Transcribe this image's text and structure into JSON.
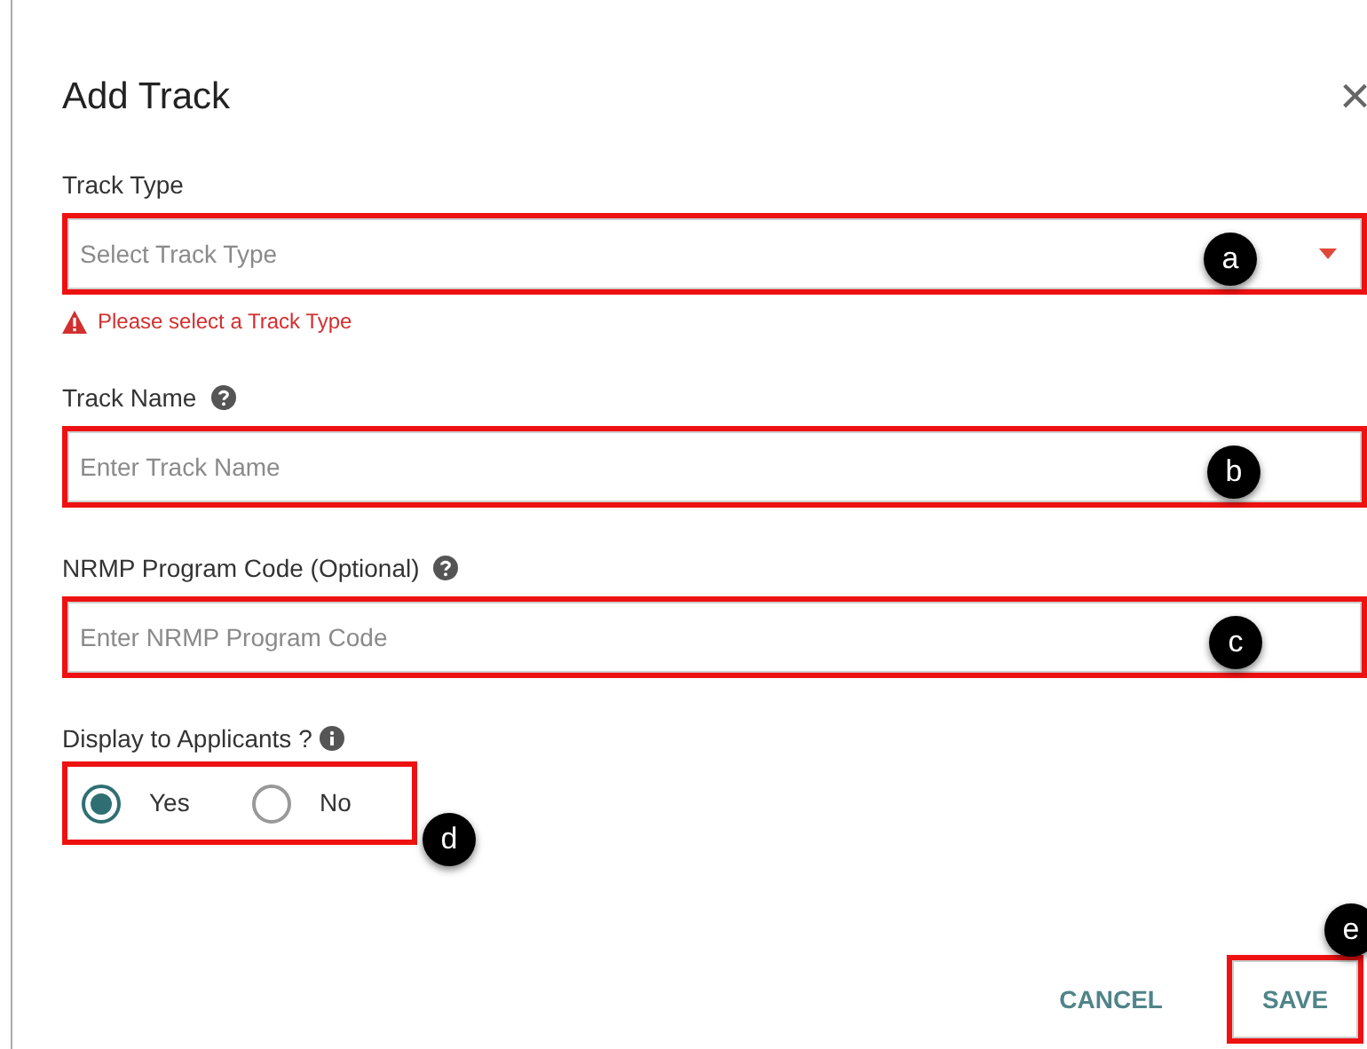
{
  "dialog": {
    "title": "Add Track",
    "close": "×"
  },
  "fields": [
    {
      "kind": "select",
      "label": "Track Type",
      "placeholder": "Select Track Type",
      "error": "Please select a Track Type",
      "annotation": "a"
    },
    {
      "kind": "text",
      "label": "Track Name",
      "hint": {
        "kind": "question"
      },
      "placeholder": "Enter Track Name",
      "annotation": "b"
    },
    {
      "kind": "text",
      "label": "NRMP Program Code (Optional)",
      "hint": {
        "kind": "question"
      },
      "placeholder": "Enter NRMP Program Code",
      "annotation": "c"
    }
  ],
  "display": {
    "label": "Display to Applicants ?",
    "hint": {
      "kind": "info"
    },
    "annotation": "d",
    "options": [
      {
        "label": "Yes",
        "selected": true
      },
      {
        "label": "No",
        "selected": false
      }
    ]
  },
  "buttons": [
    {
      "label": "CANCEL",
      "kind": "text"
    },
    {
      "label": "SAVE",
      "kind": "outlined",
      "annotation": "e"
    }
  ]
}
